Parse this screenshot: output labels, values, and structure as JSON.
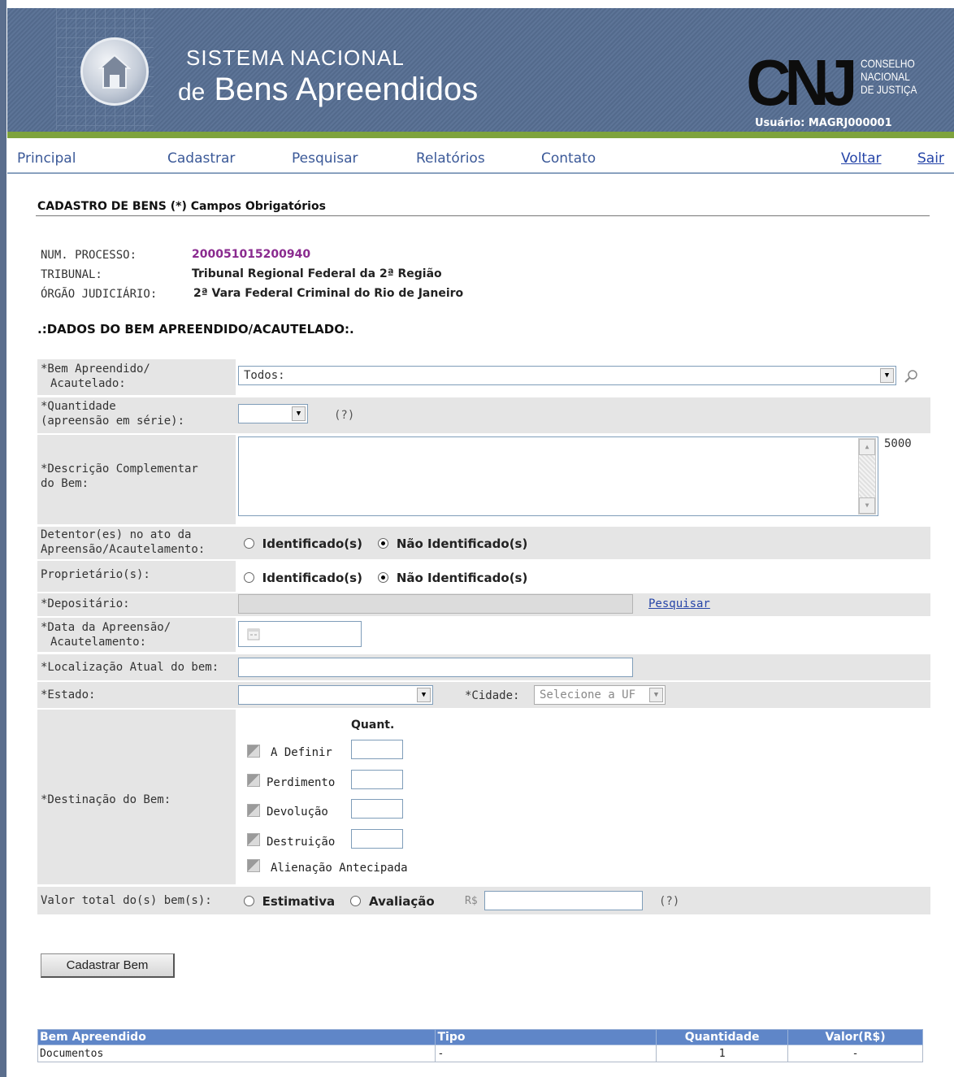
{
  "header": {
    "title_line1": "SISTEMA NACIONAL",
    "title_de": "de",
    "title_main": "Bens Apreendidos",
    "org_logo": "CNJ",
    "org_line1": "CONSELHO",
    "org_line2": "NACIONAL",
    "org_line3": "DE JUSTIÇA",
    "user": "Usuário: MAGRJ000001"
  },
  "nav": {
    "items": [
      "Principal",
      "Cadastrar",
      "Pesquisar",
      "Relatórios",
      "Contato"
    ],
    "back": "Voltar",
    "exit": "Sair"
  },
  "page": {
    "heading": "CADASTRO DE BENS (*) Campos Obrigatórios"
  },
  "processo": {
    "num_label": "NUM. PROCESSO:",
    "num_value": "200051015200940",
    "tribunal_label": "TRIBUNAL:",
    "tribunal_value": "Tribunal Regional Federal da 2ª Região",
    "orgao_label": "ÓRGÃO JUDICIÁRIO:",
    "orgao_value": "2ª Vara Federal Criminal do Rio de Janeiro"
  },
  "section": {
    "title": ".:DADOS DO BEM APREENDIDO/ACAUTELADO:."
  },
  "form": {
    "bem_label_1": "*Bem Apreendido/",
    "bem_label_2": "Acautelado:",
    "bem_value": "Todos:",
    "qtd_label_1": "*Quantidade",
    "qtd_label_2": "(apreensão em série):",
    "qtd_value": "",
    "help": "(?)",
    "desc_label_1": "*Descrição Complementar",
    "desc_label_2": "do Bem:",
    "desc_value": "",
    "desc_counter": "5000",
    "detentor_label_1": "Detentor(es) no ato da",
    "detentor_label_2": "Apreensão/Acautelamento:",
    "opt_identificado": "Identificado(s)",
    "opt_nao_identificado": "Não Identificado(s)",
    "proprietario_label": "Proprietário(s):",
    "depositario_label": "*Depositário:",
    "depositario_link": "Pesquisar",
    "data_label_1": "*Data da Apreensão/",
    "data_label_2": "Acautelamento:",
    "localizacao_label": "*Localização Atual do bem:",
    "estado_label": "*Estado:",
    "estado_value": "",
    "cidade_label": "*Cidade:",
    "cidade_value": "Selecione a UF",
    "destinacao_label": "*Destinação do Bem:",
    "quant_header": "Quant.",
    "destinacoes": [
      "A Definir",
      "Perdimento",
      "Devolução",
      "Destruição",
      "Alienação Antecipada"
    ],
    "valor_label": "Valor total do(s) bem(s):",
    "opt_estimativa": "Estimativa",
    "opt_avaliacao": "Avaliação",
    "currency": "R$",
    "submit": "Cadastrar Bem"
  },
  "table": {
    "headers": [
      "Bem Apreendido",
      "Tipo",
      "Quantidade",
      "Valor(R$)"
    ],
    "rows": [
      [
        "Documentos",
        "-",
        "1",
        "-"
      ]
    ]
  }
}
